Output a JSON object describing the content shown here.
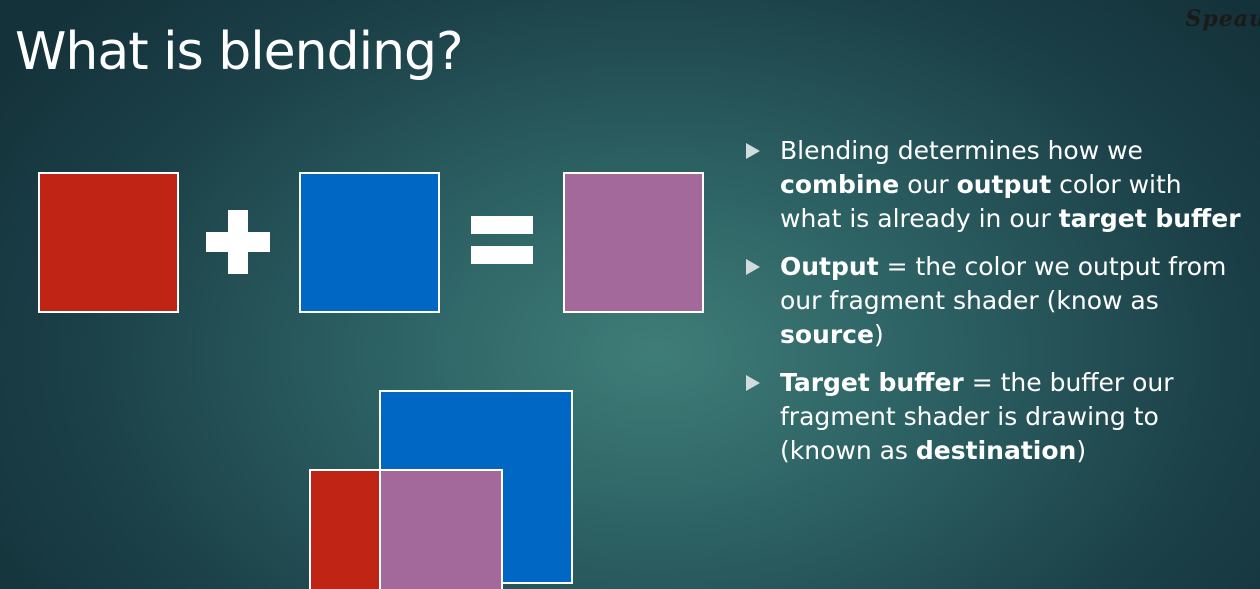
{
  "slide": {
    "title": "What is blending?",
    "watermark": "Speau"
  },
  "colors": {
    "red": "#bf2414",
    "blue": "#0067c4",
    "blended_purple": "#a4699b",
    "border": "#ffffff"
  },
  "equation": {
    "plus_symbol": "plus-icon",
    "equals_symbol": "equals-icon"
  },
  "bullets": [
    {
      "lines": [
        [
          {
            "text": "Blending determines how we",
            "bold": false
          }
        ],
        [
          {
            "text": "combine",
            "bold": true
          },
          {
            "text": " our ",
            "bold": false
          },
          {
            "text": "output",
            "bold": true
          },
          {
            "text": " color with",
            "bold": false
          }
        ],
        [
          {
            "text": "what is already in our ",
            "bold": false
          },
          {
            "text": "target buffer",
            "bold": true
          }
        ]
      ]
    },
    {
      "lines": [
        [
          {
            "text": "Output",
            "bold": true
          },
          {
            "text": " = the color we output from",
            "bold": false
          }
        ],
        [
          {
            "text": "our fragment shader (know as",
            "bold": false
          }
        ],
        [
          {
            "text": "source",
            "bold": true
          },
          {
            "text": ")",
            "bold": false
          }
        ]
      ]
    },
    {
      "lines": [
        [
          {
            "text": "Target buffer",
            "bold": true
          },
          {
            "text": " = the buffer our",
            "bold": false
          }
        ],
        [
          {
            "text": "fragment shader is drawing to",
            "bold": false
          }
        ],
        [
          {
            "text": "(known as ",
            "bold": false
          },
          {
            "text": "destination",
            "bold": true
          },
          {
            "text": ")",
            "bold": false
          }
        ]
      ]
    }
  ]
}
